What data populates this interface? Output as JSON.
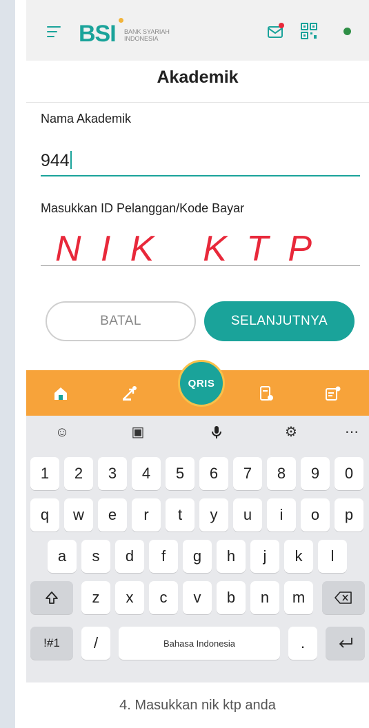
{
  "header": {
    "logo_text": "BSI",
    "logo_sub": "BANK SYARIAH INDONESIA",
    "page_title": "Akademik"
  },
  "form": {
    "academy_label": "Nama Akademik",
    "academy_value": "944",
    "id_label": "Masukkan ID Pelanggan/Kode Bayar",
    "id_handwritten": "NIK KTP"
  },
  "buttons": {
    "cancel": "BATAL",
    "next": "SELANJUTNYA"
  },
  "nav": {
    "qris": "QRIS"
  },
  "keyboard": {
    "numbers": [
      "1",
      "2",
      "3",
      "4",
      "5",
      "6",
      "7",
      "8",
      "9",
      "0"
    ],
    "row1": [
      "q",
      "w",
      "e",
      "r",
      "t",
      "y",
      "u",
      "i",
      "o",
      "p"
    ],
    "row2": [
      "a",
      "s",
      "d",
      "f",
      "g",
      "h",
      "j",
      "k",
      "l"
    ],
    "row3": [
      "z",
      "x",
      "c",
      "v",
      "b",
      "n",
      "m"
    ],
    "symbols": "!#1",
    "slash": "/",
    "space": "Bahasa Indonesia",
    "period": "."
  },
  "caption": "4. Masukkan nik ktp anda",
  "colors": {
    "accent": "#1aa39a",
    "nav": "#f7a33a",
    "handwriting": "#e8283a"
  }
}
